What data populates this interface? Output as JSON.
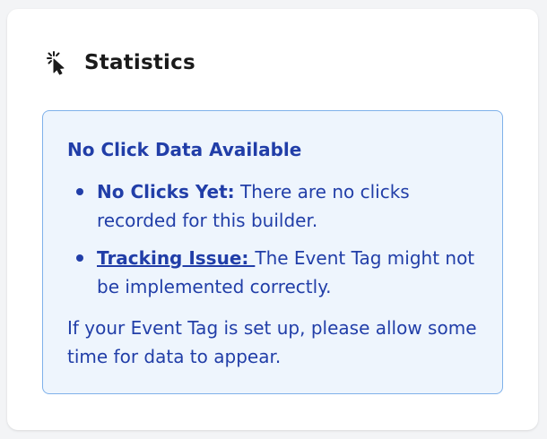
{
  "card": {
    "title": "Statistics",
    "icon": "pointer-click-icon"
  },
  "alert": {
    "title": "No Click Data Available",
    "items": [
      {
        "label": "No Clicks Yet:",
        "text": " There are no clicks recorded for this builder."
      },
      {
        "label": "Tracking Issue: ",
        "text": " The Event Tag might not be implemented correctly."
      }
    ],
    "footer": "If your Event Tag is set up, please allow some time for data to appear."
  },
  "colors": {
    "alert_text": "#213ea8",
    "alert_bg": "#eef5fd",
    "alert_border": "#7fb1ea",
    "title_text": "#1a1a1a"
  }
}
